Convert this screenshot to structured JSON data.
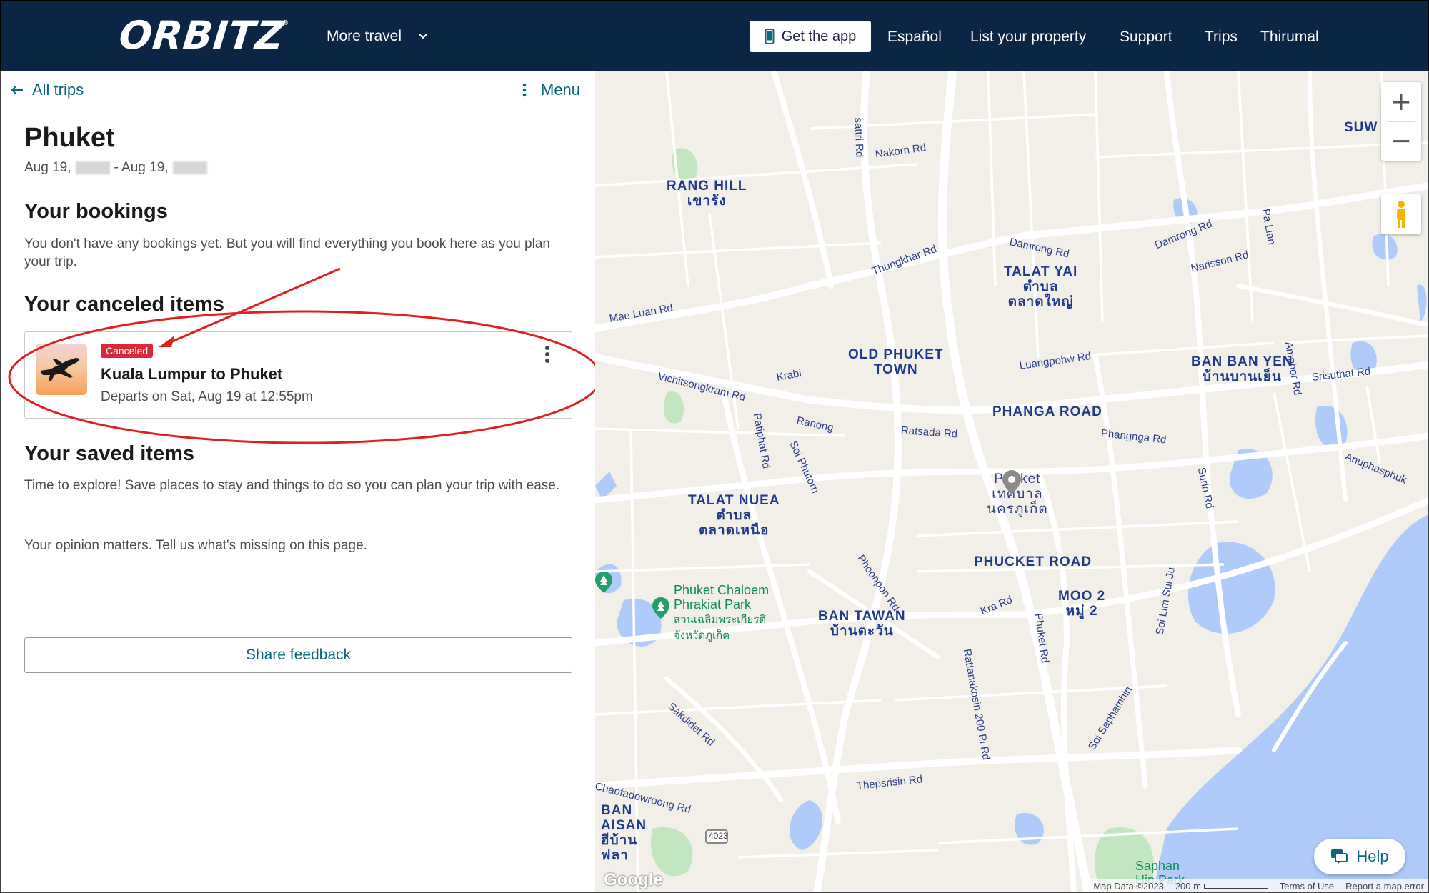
{
  "header": {
    "logo_text": "ORBITZ",
    "logo_mark": "®",
    "more_travel_label": "More travel",
    "get_app_label": "Get the app",
    "links": {
      "espanol": "Español",
      "list_property": "List your property",
      "support": "Support",
      "trips": "Trips",
      "user": "Thirumal"
    }
  },
  "left_panel": {
    "back_label": "All trips",
    "menu_label": "Menu",
    "trip_title": "Phuket",
    "date_start": "Aug 19,",
    "date_sep": "- Aug 19,",
    "bookings": {
      "heading": "Your bookings",
      "text": "You don't have any bookings yet. But you will find everything you book here as you plan your trip."
    },
    "canceled": {
      "heading": "Your canceled items",
      "item": {
        "badge": "Canceled",
        "title": "Kuala Lumpur to Phuket",
        "subtitle": "Departs on Sat, Aug 19 at 12:55pm"
      }
    },
    "saved": {
      "heading": "Your saved items",
      "text": "Time to explore! Save places to stay and things to do so you can plan your trip with ease."
    },
    "opinion_text": "Your opinion matters. Tell us what's missing on this page.",
    "feedback_button": "Share feedback"
  },
  "map": {
    "areas": {
      "rang_hill": "RANG HILL",
      "rang_hill_th": "เขารัง",
      "talat_yai": "TALAT YAI",
      "talat_yai_th1": "ตำบล",
      "talat_yai_th2": "ตลาดใหญ่",
      "old_phuket": "OLD PHUKET",
      "old_phuket_2": "TOWN",
      "ban_ban_yen": "BAN BAN YEN",
      "ban_ban_yen_th": "บ้านบานเย็น",
      "phanga_road": "PHANGA ROAD",
      "talat_nuea": "TALAT NUEA",
      "talat_nuea_th1": "ตำบล",
      "talat_nuea_th2": "ตลาดเหนือ",
      "phucket_road": "PHUCKET ROAD",
      "moo2": "MOO 2",
      "moo2_th": "หมู่ 2",
      "ban_tawan": "BAN TAWAN",
      "ban_tawan_th": "บ้านตะวัน",
      "ban_aisan": "BAN",
      "ban_aisan_2": "AISAN",
      "ban_aisan_th": "ฮีบ้าน",
      "ban_aisan_th2": "ฟลา",
      "suw": "SUW",
      "phuket_city": "Phuket",
      "phuket_city_th1": "เทศบาล",
      "phuket_city_th2": "นครภูเก็ต"
    },
    "park": {
      "name1": "Phuket Chaloem",
      "name2": "Phrakiat Park",
      "th1": "สวนเฉลิมพระเกียรติ",
      "th2": "จังหวัดภูเก็ต",
      "saphan": "Saphan",
      "saphan2": "Hin Park"
    },
    "roads": {
      "nakorn": "Nakorn Rd",
      "thungkhar": "Thungkhar Rd",
      "damrong1": "Damrong Rd",
      "damrong2": "Damrong Rd",
      "narisson": "Narisson Rd",
      "mae_luan": "Mae Luan Rd",
      "vichitsongkram": "Vichitsongkram Rd",
      "krabi": "Krabi",
      "luangpohw": "Luangpohw Rd",
      "srisuthat": "Srisuthat Rd",
      "ranong": "Ranong",
      "ratsada": "Ratsada Rd",
      "phangnga": "Phangnga Rd",
      "anuphasphuk": "Anuphasphuk",
      "patiphat": "Patiphat Rd",
      "soi_phutorn": "Soi Phutorn",
      "phoonpon": "Phoonpon Rd",
      "kra": "Kra Rd",
      "phuket_rd": "Phuket Rd",
      "soi_lim_sui": "Soi Lim Sui Ju",
      "rattanakosin": "Rattanakosin 200 Pi Rd",
      "sakdidet": "Sakdidet Rd",
      "soi_saphamhin": "Soi Saphamhin",
      "thepsrisin": "Thepsrisin Rd",
      "chaofadowroong": "Chaofadowroong Rd",
      "sattri": "sattri Rd",
      "pa_lian": "Pa Lian",
      "amphor": "Amphor Rd",
      "surin": "Surin Rd",
      "route": "4023"
    },
    "help_label": "Help",
    "google": "Google",
    "footer": {
      "map_data": "Map Data ©2023",
      "scale": "200 m",
      "terms": "Terms of Use",
      "report": "Report a map error"
    },
    "colors": {
      "water": "#aecbfa",
      "park": "#c2e7c0",
      "road": "#ffffff",
      "land": "#f2efe9"
    }
  },
  "colors": {
    "header_bg": "#0b2545",
    "link": "#0a6779",
    "badge": "#d8283a",
    "annotation": "#e02020"
  }
}
